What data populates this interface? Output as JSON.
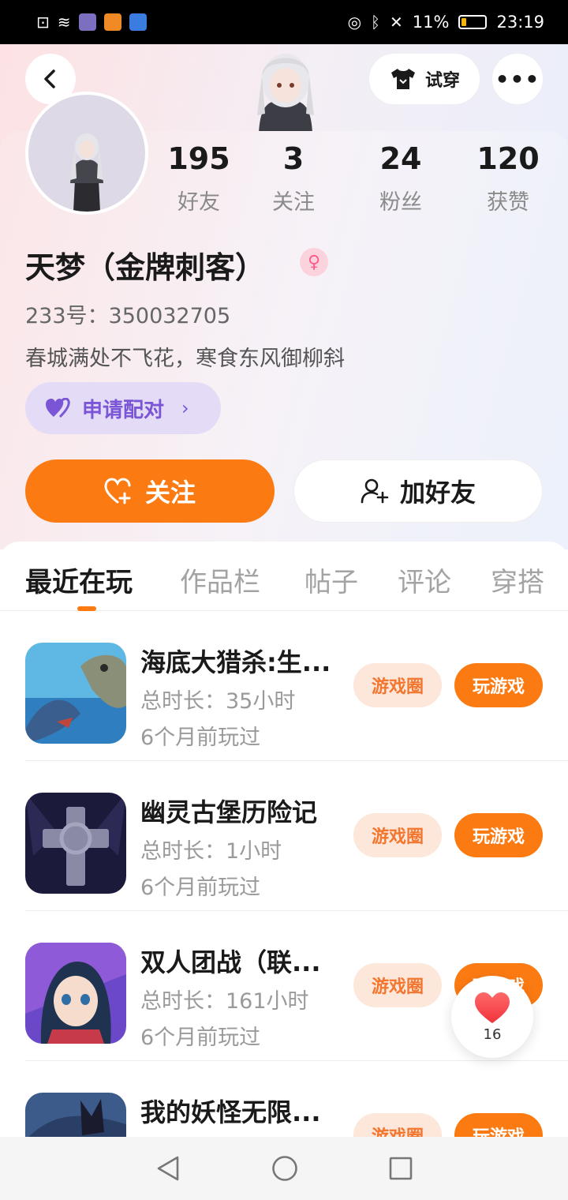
{
  "status_bar": {
    "battery_percent": "11%",
    "time": "23:19"
  },
  "header": {
    "tryon_label": "试穿"
  },
  "stats": [
    {
      "value": "195",
      "label": "好友"
    },
    {
      "value": "3",
      "label": "关注"
    },
    {
      "value": "24",
      "label": "粉丝"
    },
    {
      "value": "120",
      "label": "获赞"
    }
  ],
  "profile": {
    "name": "天梦（金牌刺客）",
    "gender_symbol": "♀",
    "id_text": "233号：350032705",
    "bio": "春城满处不飞花，寒食东风御柳斜",
    "pair_label": "申请配对"
  },
  "actions": {
    "follow_label": "关注",
    "add_friend_label": "加好友"
  },
  "tabs": [
    {
      "label": "最近在玩",
      "active": true
    },
    {
      "label": "作品栏",
      "active": false
    },
    {
      "label": "帖子",
      "active": false
    },
    {
      "label": "评论",
      "active": false
    },
    {
      "label": "穿搭",
      "active": false
    }
  ],
  "games": [
    {
      "title": "海底大猎杀:生...",
      "duration": "总时长：35小时",
      "last_played": "6个月前玩过",
      "circle_label": "游戏圈",
      "play_label": "玩游戏"
    },
    {
      "title": "幽灵古堡历险记",
      "duration": "总时长：1小时",
      "last_played": "6个月前玩过",
      "circle_label": "游戏圈",
      "play_label": "玩游戏"
    },
    {
      "title": "双人团战（联...",
      "duration": "总时长：161小时",
      "last_played": "6个月前玩过",
      "circle_label": "游戏圈",
      "play_label": "玩游戏"
    },
    {
      "title": "我的妖怪无限...",
      "duration": "",
      "last_played": "",
      "circle_label": "游戏圈",
      "play_label": "玩游戏"
    }
  ],
  "like_fab": {
    "count": "16"
  },
  "colors": {
    "accent": "#fc7a12",
    "pair_purple": "#7a55d6",
    "circle_bg": "#fde6da"
  }
}
